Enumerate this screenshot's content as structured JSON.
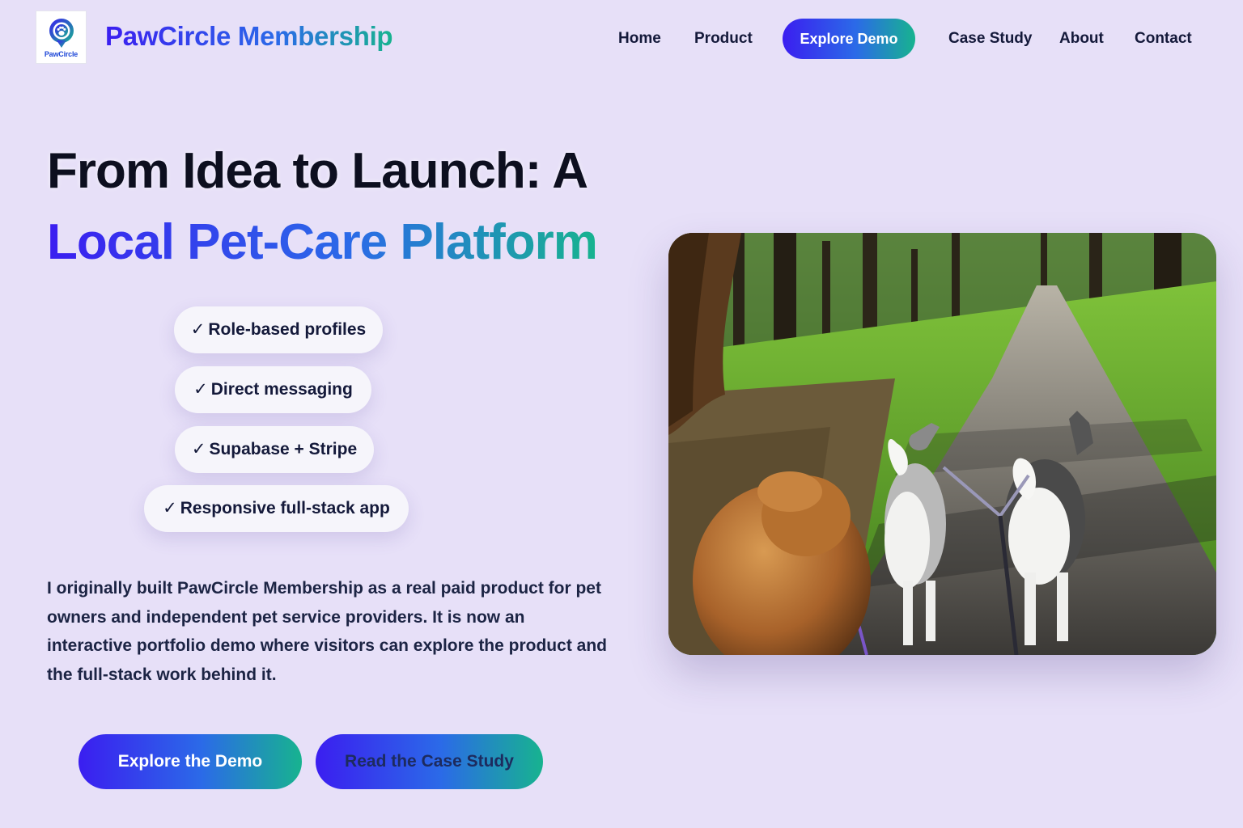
{
  "header": {
    "logo_text": "PawCircle",
    "brand": "PawCircle Membership"
  },
  "nav": {
    "home": "Home",
    "product": "Product",
    "explore_demo": "Explore Demo",
    "case_study": "Case Study",
    "about": "About",
    "contact": "Contact"
  },
  "hero": {
    "title_line1": "From Idea to Launch: A",
    "title_line2": "Local Pet-Care Platform",
    "features": [
      "Role-based profiles",
      "Direct messaging",
      "Supabase + Stripe",
      "Responsive full-stack app"
    ],
    "check_glyph": "✓",
    "intro": "I originally built PawCircle Membership as a real paid product for pet owners and independent pet service providers. It is now an interactive portfolio demo where visitors can explore the product and the full-stack work behind it.",
    "primary_button": "Explore the Demo",
    "secondary_button": "Read the Case Study"
  },
  "image": {
    "icon": "photo-dogs-walking-park-path"
  },
  "colors": {
    "background": "#e7e0f8",
    "gradient_start": "#3b1ef0",
    "gradient_mid": "#2b6ae8",
    "gradient_end": "#17b38f",
    "text_dark": "#14193a"
  }
}
